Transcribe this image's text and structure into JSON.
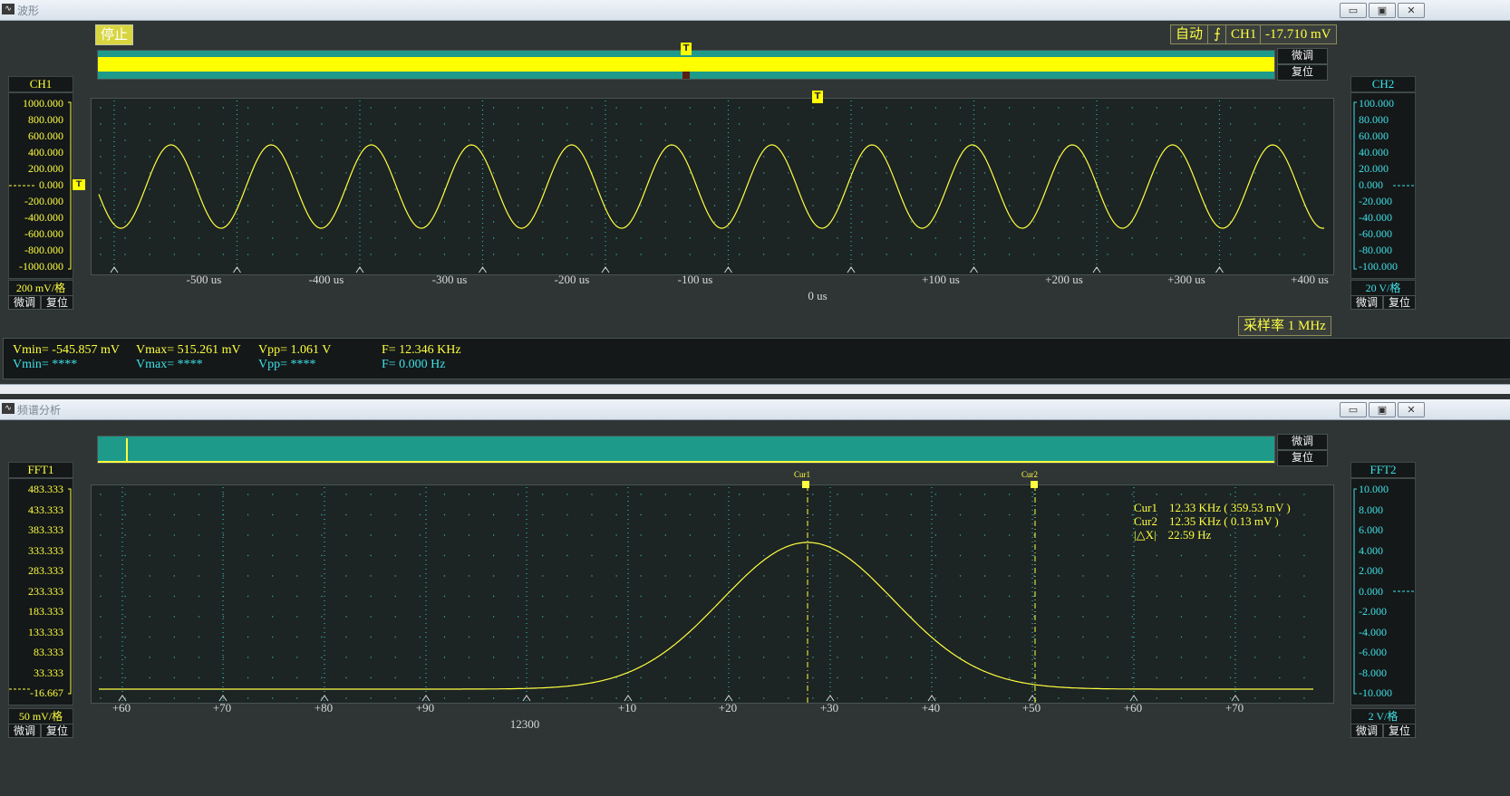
{
  "wave_window": {
    "title": "波形",
    "icon": "waveform-app-icon",
    "stop_label": "停止",
    "trigger_mode": "自动",
    "trigger_channel": "CH1",
    "trigger_level": "-17.710 mV",
    "fine_label": "微调",
    "reset_label": "复位",
    "trigger_marker": "T",
    "level_marker": "T",
    "ch1": {
      "label": "CH1",
      "ticks": [
        "1000.000",
        "800.000",
        "600.000",
        "400.000",
        "200.000",
        "0.000",
        "-200.000",
        "-400.000",
        "-600.000",
        "-800.000",
        "-1000.000"
      ],
      "scale": "200 mV/格",
      "fine": "微调",
      "reset": "复位"
    },
    "ch2": {
      "label": "CH2",
      "ticks": [
        "100.000",
        "80.000",
        "60.000",
        "40.000",
        "20.000",
        "0.000",
        "-20.000",
        "-40.000",
        "-60.000",
        "-80.000",
        "-100.000"
      ],
      "scale": "20 V/格",
      "fine": "微调",
      "reset": "复位"
    },
    "x_ticks": [
      "-500 us",
      "-400 us",
      "-300 us",
      "-200 us",
      "-100 us",
      "0 us",
      "+100 us",
      "+200 us",
      "+300 us",
      "+400 us"
    ],
    "x_center": "0 us",
    "sample_rate": "采样率 1 MHz",
    "measurements": {
      "ch1_vmin": "Vmin= -545.857 mV",
      "ch1_vmax": "Vmax= 515.261 mV",
      "ch1_vpp": "Vpp= 1.061 V",
      "ch1_freq": "F= 12.346 KHz",
      "ch2_vmin": "Vmin= ****",
      "ch2_vmax": "Vmax= ****",
      "ch2_vpp": "Vpp= ****",
      "ch2_freq": "F= 0.000 Hz"
    }
  },
  "fft_window": {
    "title": "频谱分析",
    "icon": "spectrum-app-icon",
    "fine_label": "微调",
    "reset_label": "复位",
    "fft1": {
      "label": "FFT1",
      "ticks": [
        "483.333",
        "433.333",
        "383.333",
        "333.333",
        "283.333",
        "233.333",
        "183.333",
        "133.333",
        "83.333",
        "33.333",
        "-16.667"
      ],
      "scale": "50 mV/格",
      "fine": "微调",
      "reset": "复位"
    },
    "fft2": {
      "label": "FFT2",
      "ticks": [
        "10.000",
        "8.000",
        "6.000",
        "4.000",
        "2.000",
        "0.000",
        "-2.000",
        "-4.000",
        "-6.000",
        "-8.000",
        "-10.000"
      ],
      "scale": "2 V/格",
      "fine": "微调",
      "reset": "复位"
    },
    "x_ticks": [
      "+60",
      "+70",
      "+80",
      "+90",
      "+10",
      "+20",
      "+30",
      "+40",
      "+50",
      "+60",
      "+70"
    ],
    "x_base": "12300",
    "cursor1_label": "Cur1",
    "cursor2_label": "Cur2",
    "readout": {
      "cur1": "Cur1    12.33 KHz ( 359.53 mV )",
      "cur2": "Cur2    12.35 KHz ( 0.13 mV )",
      "delta": "|△X|    22.59 Hz"
    }
  },
  "colors": {
    "trace": "#ffff40",
    "ch2": "#40e0e8",
    "grid": "#2fb8b0",
    "plot_bg": "#1c2424",
    "panel_bg": "#2f3535",
    "overview_bar": "#1e9a8a"
  }
}
